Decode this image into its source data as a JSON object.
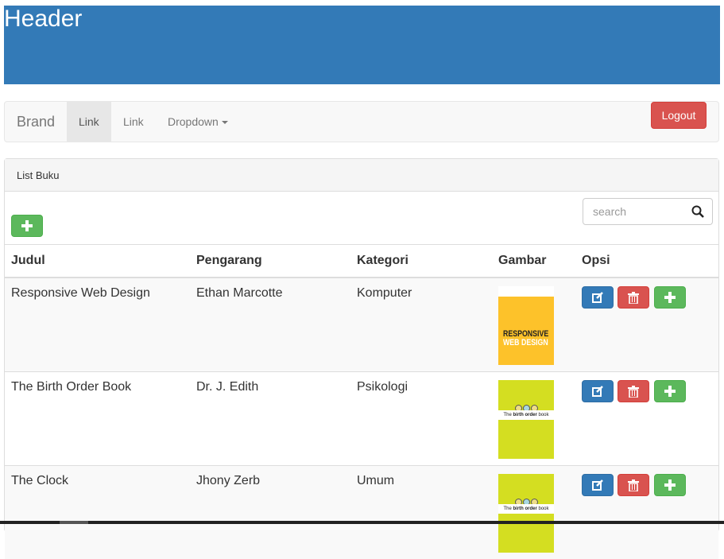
{
  "header": {
    "title": "Header"
  },
  "navbar": {
    "brand": "Brand",
    "links": [
      "Link",
      "Link"
    ],
    "dropdown": "Dropdown",
    "logout": "Logout"
  },
  "panel": {
    "title": "List Buku",
    "search_placeholder": "search"
  },
  "table": {
    "columns": [
      "Judul",
      "Pengarang",
      "Kategori",
      "Gambar",
      "Opsi"
    ],
    "rows": [
      {
        "judul": "Responsive Web Design",
        "pengarang": "Ethan Marcotte",
        "kategori": "Komputer",
        "cover": "responsive-web-design",
        "cover_text": "RESPONSIVE WEB DESIGN"
      },
      {
        "judul": "The Birth Order Book",
        "pengarang": "Dr. J. Edith",
        "kategori": "Psikologi",
        "cover": "birth-order-book",
        "cover_text": "The birth order book"
      },
      {
        "judul": "The Clock",
        "pengarang": "Jhony Zerb",
        "kategori": "Umum",
        "cover": "birth-order-book",
        "cover_text": "The birth order book"
      }
    ]
  },
  "colors": {
    "header": "#337ab7",
    "danger": "#d9534f",
    "success": "#5cb85c",
    "primary": "#337ab7"
  }
}
